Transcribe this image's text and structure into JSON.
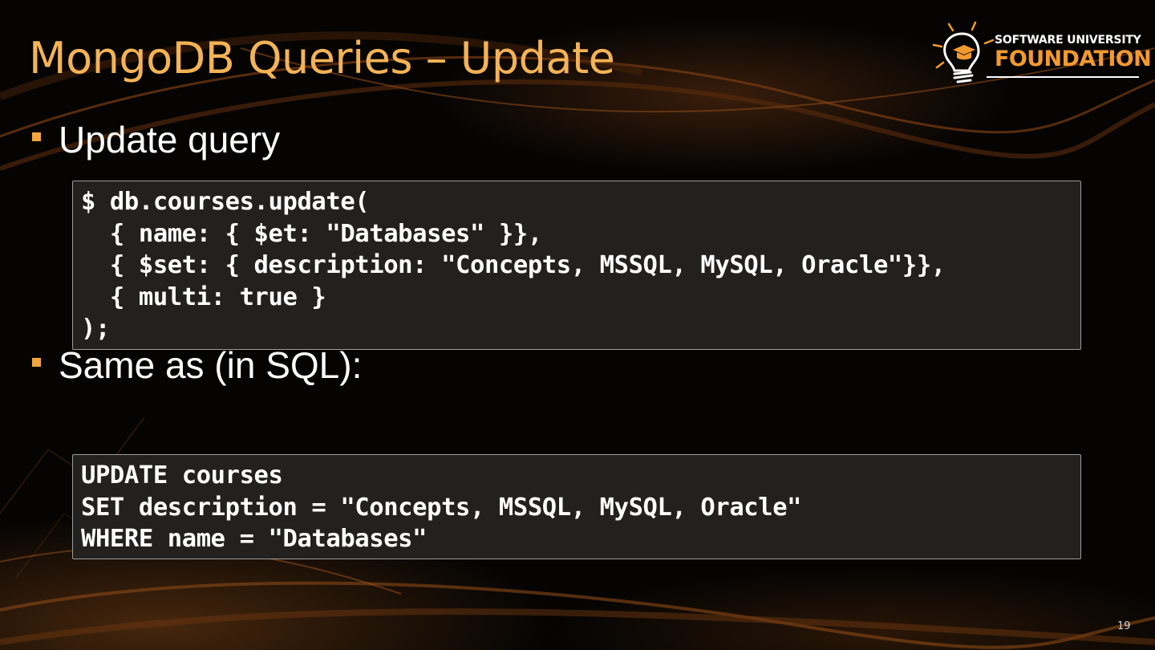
{
  "slide": {
    "title": "MongoDB Queries – Update",
    "page_number": "19"
  },
  "logo": {
    "top_text": "SOFTWARE UNIVERSITY",
    "bottom_text": "FOUNDATION",
    "icon": "lightbulb-graduation-cap-icon"
  },
  "bullets": [
    {
      "text": "Update query",
      "marker": "square-bullet-icon"
    },
    {
      "text": "Same as (in SQL):",
      "marker": "square-bullet-icon"
    }
  ],
  "code_blocks": {
    "mongo": [
      "$ db.courses.update(",
      "  { name: { $et: \"Databases\" }},",
      "  { $set: { description: \"Concepts, MSSQL, MySQL, Oracle\"}},",
      "  { multi: true }",
      ");"
    ],
    "sql": [
      "UPDATE courses",
      "SET description = \"Concepts, MSSQL, MySQL, Oracle\"",
      "WHERE name = \"Databases\""
    ]
  },
  "colors": {
    "title": "#f3b356",
    "accent_orange": "#f39a2e",
    "code_background": "#222120",
    "code_border": "#9c9c9c",
    "bullet_text": "#ffffff"
  }
}
